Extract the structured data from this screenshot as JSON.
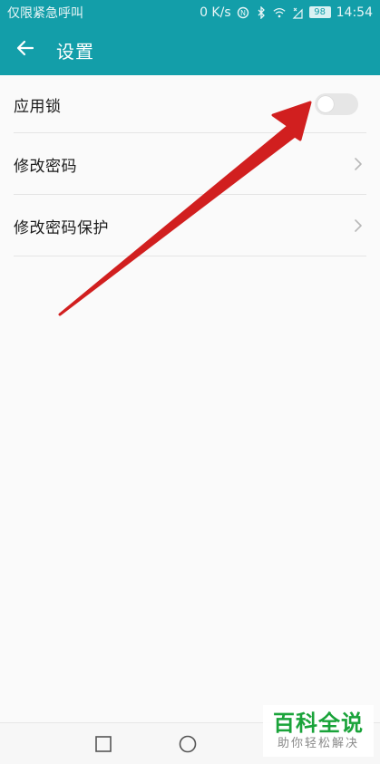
{
  "status_bar": {
    "left_text": "仅限紧急呼叫",
    "speed": "0 K/s",
    "battery": "98",
    "time": "14:54"
  },
  "app_bar": {
    "title": "设置",
    "back_icon": "arrow-left-icon"
  },
  "settings": [
    {
      "label": "应用锁",
      "control": "toggle",
      "toggle_on": false
    },
    {
      "label": "修改密码",
      "control": "chevron"
    },
    {
      "label": "修改密码保护",
      "control": "chevron"
    }
  ],
  "nav_bar": {
    "icons": [
      "recent-apps-icon",
      "home-icon"
    ]
  },
  "watermark": {
    "main": "百科全说",
    "sub": "助你轻松解决"
  },
  "colors": {
    "primary": "#139ea9",
    "annotation_arrow": "#d11f1f",
    "watermark_green": "#1aa33a"
  }
}
